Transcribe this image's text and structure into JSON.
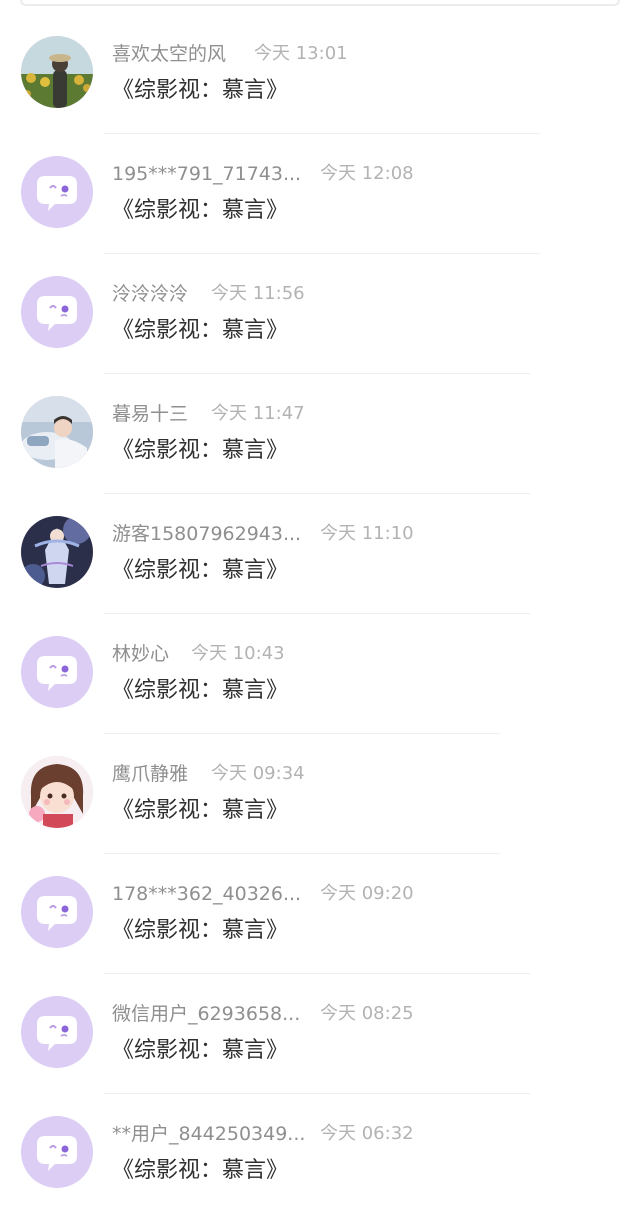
{
  "messages": [
    {
      "name": "喜欢太空的风",
      "time": "今天 13:01",
      "text": "《综影视：慕言》",
      "avatar": "sunflower-photo-avatar-icon"
    },
    {
      "name": "195***791_71743...",
      "time": "今天 12:08",
      "text": "《综影视：慕言》",
      "avatar": "default-chat-bubble-avatar-icon"
    },
    {
      "name": "泠泠泠泠",
      "time": "今天 11:56",
      "text": "《综影视：慕言》",
      "avatar": "default-chat-bubble-avatar-icon"
    },
    {
      "name": "暮易十三",
      "time": "今天 11:47",
      "text": "《综影视：慕言》",
      "avatar": "sleeping-person-photo-avatar-icon"
    },
    {
      "name": "游客15807962943...",
      "time": "今天 11:10",
      "text": "《综影视：慕言》",
      "avatar": "anime-character-avatar-icon"
    },
    {
      "name": "林妙心",
      "time": "今天 10:43",
      "text": "《综影视：慕言》",
      "avatar": "default-chat-bubble-avatar-icon"
    },
    {
      "name": "鹰爪静雅",
      "time": "今天 09:34",
      "text": "《综影视：慕言》",
      "avatar": "cartoon-girl-avatar-icon"
    },
    {
      "name": "178***362_40326...",
      "time": "今天 09:20",
      "text": "《综影视：慕言》",
      "avatar": "default-chat-bubble-avatar-icon"
    },
    {
      "name": "微信用户_6293658...",
      "time": "今天 08:25",
      "text": "《综影视：慕言》",
      "avatar": "default-chat-bubble-avatar-icon"
    },
    {
      "name": "**用户_844250349...",
      "time": "今天 06:32",
      "text": "《综影视：慕言》",
      "avatar": "default-chat-bubble-avatar-icon"
    }
  ]
}
